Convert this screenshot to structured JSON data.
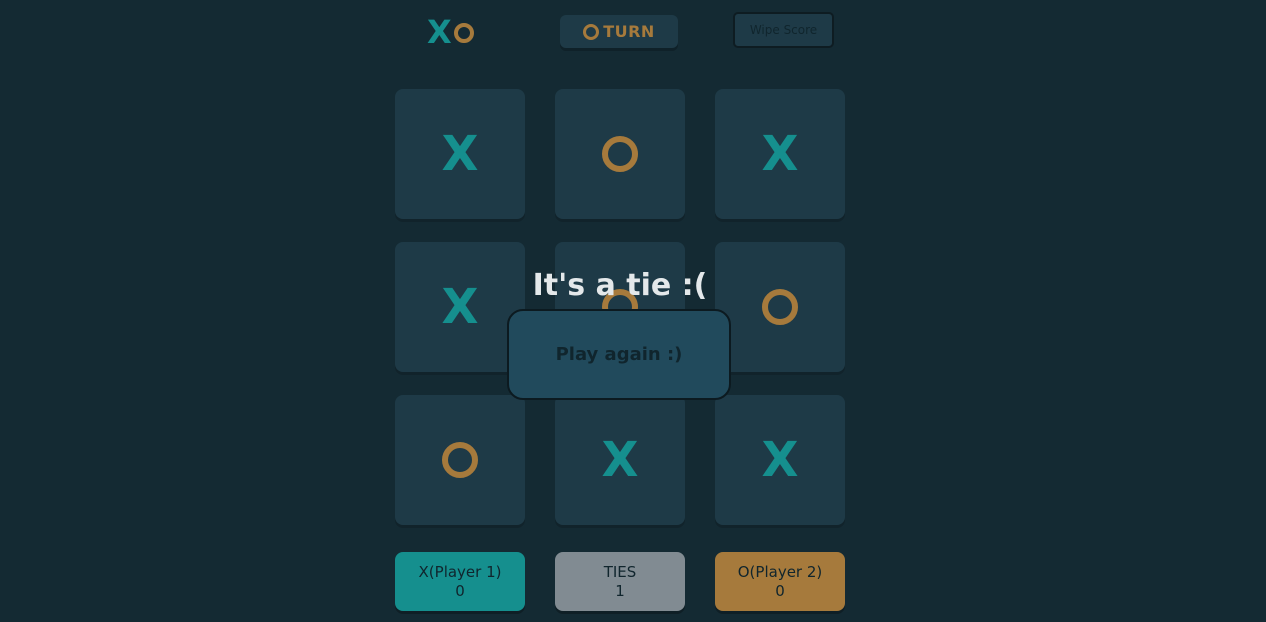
{
  "colors": {
    "background": "#142a33",
    "x_color": "#158f8e",
    "o_color": "#a67a3c",
    "cell_bg": "#1e3a47",
    "button_bg": "#214a5c",
    "turn_bg": "#1e3a47",
    "ties_bg": "#818b92",
    "dark_text": "#10252d",
    "light_text": "#e4e8ea"
  },
  "header": {
    "logo_x": "X",
    "turn_label": "TURN",
    "turn_player": "O",
    "wipe_label": "Wipe Score"
  },
  "board": [
    "X",
    "O",
    "X",
    "X",
    "O",
    "O",
    "O",
    "X",
    "X"
  ],
  "overlay": {
    "message": "It's a tie :(",
    "play_again": "Play again :)"
  },
  "score": {
    "x_label": "X(Player 1)",
    "x_value": "0",
    "ties_label": "TIES",
    "ties_value": "1",
    "o_label": "O(Player 2)",
    "o_value": "0"
  }
}
